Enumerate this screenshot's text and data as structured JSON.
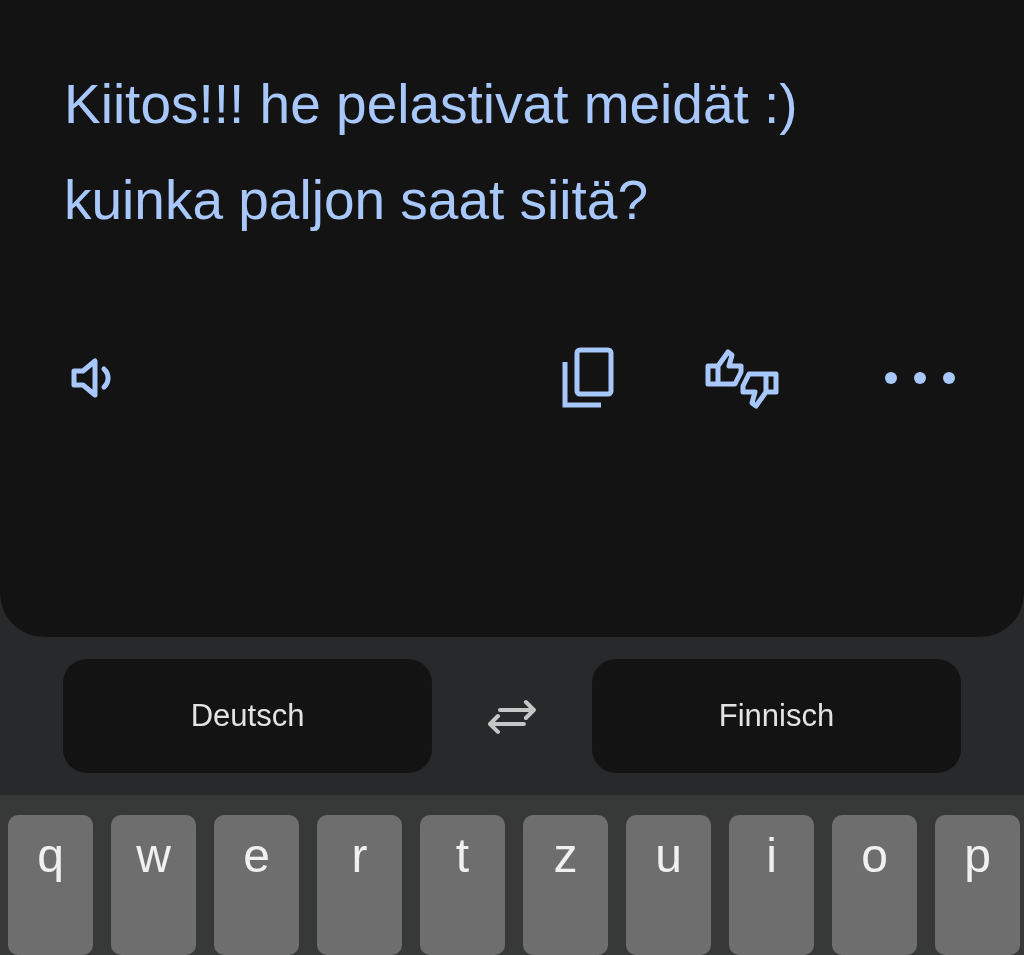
{
  "translation": {
    "text": "Kiitos!!! he pelastivat meidät :) kuinka paljon saat siitä?"
  },
  "languages": {
    "source": "Deutsch",
    "target": "Finnisch"
  },
  "keyboard": {
    "keys": [
      "q",
      "w",
      "e",
      "r",
      "t",
      "z",
      "u",
      "i",
      "o",
      "p"
    ]
  }
}
